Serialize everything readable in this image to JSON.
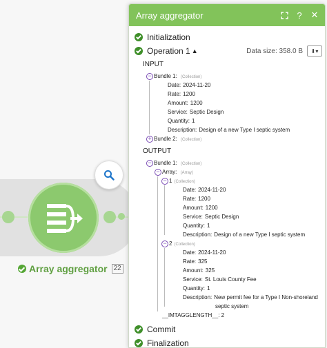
{
  "module": {
    "name": "Array aggregator",
    "badge": "22",
    "colors": {
      "accent": "#82c35a",
      "module_fill": "#8cc96e",
      "label": "#5f9f41"
    },
    "icons": [
      "aggregator-icon",
      "search-icon",
      "status-check-icon"
    ]
  },
  "panel": {
    "title": "Array aggregator",
    "header_icons": [
      "expand-icon",
      "help-icon",
      "close-icon"
    ],
    "phases": {
      "initialization": "Initialization",
      "operation": "Operation 1",
      "commit": "Commit",
      "finalization": "Finalization"
    },
    "data_size": "Data size: 358.0 B",
    "input_label": "INPUT",
    "output_label": "OUTPUT",
    "collection_type": "(Collection)",
    "array_type": "(Array)",
    "input": {
      "bundle1": {
        "label": "Bundle 1:",
        "fields": [
          {
            "key": "Date:",
            "value": "2024-11-20"
          },
          {
            "key": "Rate:",
            "value": "1200"
          },
          {
            "key": "Amount:",
            "value": "1200"
          },
          {
            "key": "Service:",
            "value": "Septic Design"
          },
          {
            "key": "Quantity:",
            "value": "1"
          },
          {
            "key": "Description:",
            "value": "Design of a new Type I septic system"
          }
        ]
      },
      "bundle2": {
        "label": "Bundle 2:"
      }
    },
    "output": {
      "bundle1_label": "Bundle 1:",
      "array_label": "Array:",
      "items": [
        {
          "index": "1",
          "fields": [
            {
              "key": "Date:",
              "value": "2024-11-20"
            },
            {
              "key": "Rate:",
              "value": "1200"
            },
            {
              "key": "Amount:",
              "value": "1200"
            },
            {
              "key": "Service:",
              "value": "Septic Design"
            },
            {
              "key": "Quantity:",
              "value": "1"
            },
            {
              "key": "Description:",
              "value": "Design of a new Type I septic system"
            }
          ]
        },
        {
          "index": "2",
          "fields": [
            {
              "key": "Date:",
              "value": "2024-11-20"
            },
            {
              "key": "Rate:",
              "value": "325"
            },
            {
              "key": "Amount:",
              "value": "325"
            },
            {
              "key": "Service:",
              "value": "St. Louis County Fee"
            },
            {
              "key": "Quantity:",
              "value": "1"
            },
            {
              "key": "Description:",
              "value": "New permit fee for a Type I Non-shoreland"
            }
          ],
          "description_cont": "septic system"
        }
      ],
      "length_key": "__IMTAGGLENGTH__:",
      "length_value": "2"
    }
  }
}
